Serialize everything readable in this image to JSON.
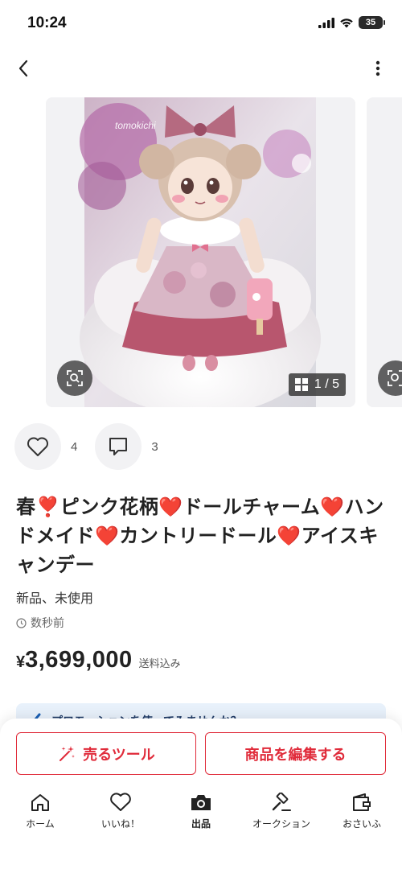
{
  "status_bar": {
    "time": "10:24",
    "battery": "35"
  },
  "product": {
    "image": {
      "watermark": "tomokichi",
      "page_current": "1",
      "page_total": "5",
      "page_label": "1 / 5"
    },
    "likes_count": "4",
    "comments_count": "3",
    "title": "春❣️ピンク花柄❤️ドールチャーム❤️ハンドメイド❤️カントリードール❤️アイスキャンデー",
    "condition": "新品、未使用",
    "posted": "数秒前",
    "currency_symbol": "¥",
    "price": "3,699,000",
    "shipping": "送料込み"
  },
  "promo": {
    "text": "プロモーションを使ってみませんか？"
  },
  "actions": {
    "sell_tool": "売るツール",
    "edit": "商品を編集する"
  },
  "tabs": [
    {
      "label": "ホーム",
      "icon": "home-icon"
    },
    {
      "label": "いいね！",
      "icon": "heart-icon"
    },
    {
      "label": "出品",
      "icon": "camera-icon"
    },
    {
      "label": "オークション",
      "icon": "gavel-icon"
    },
    {
      "label": "おさいふ",
      "icon": "wallet-icon"
    }
  ],
  "colors": {
    "accent": "#e02b3a",
    "promo_bg": "#e8f1fb",
    "card_bg": "#f2f2f4"
  }
}
